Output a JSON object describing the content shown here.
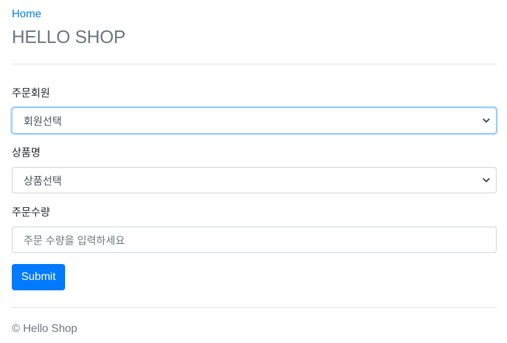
{
  "header": {
    "home_link": "Home",
    "title": "HELLO SHOP"
  },
  "form": {
    "member": {
      "label": "주문회원",
      "selected": "회원선택"
    },
    "item": {
      "label": "상품명",
      "selected": "상품선택"
    },
    "count": {
      "label": "주문수량",
      "placeholder": "주문 수량을 입력하세요",
      "value": ""
    },
    "submit_label": "Submit"
  },
  "footer": {
    "text": "© Hello Shop"
  },
  "colors": {
    "primary": "#007bff",
    "muted": "#6c757d",
    "focus_border": "#80bdff"
  },
  "icons": {
    "select_arrow": "chevron-down-icon"
  }
}
